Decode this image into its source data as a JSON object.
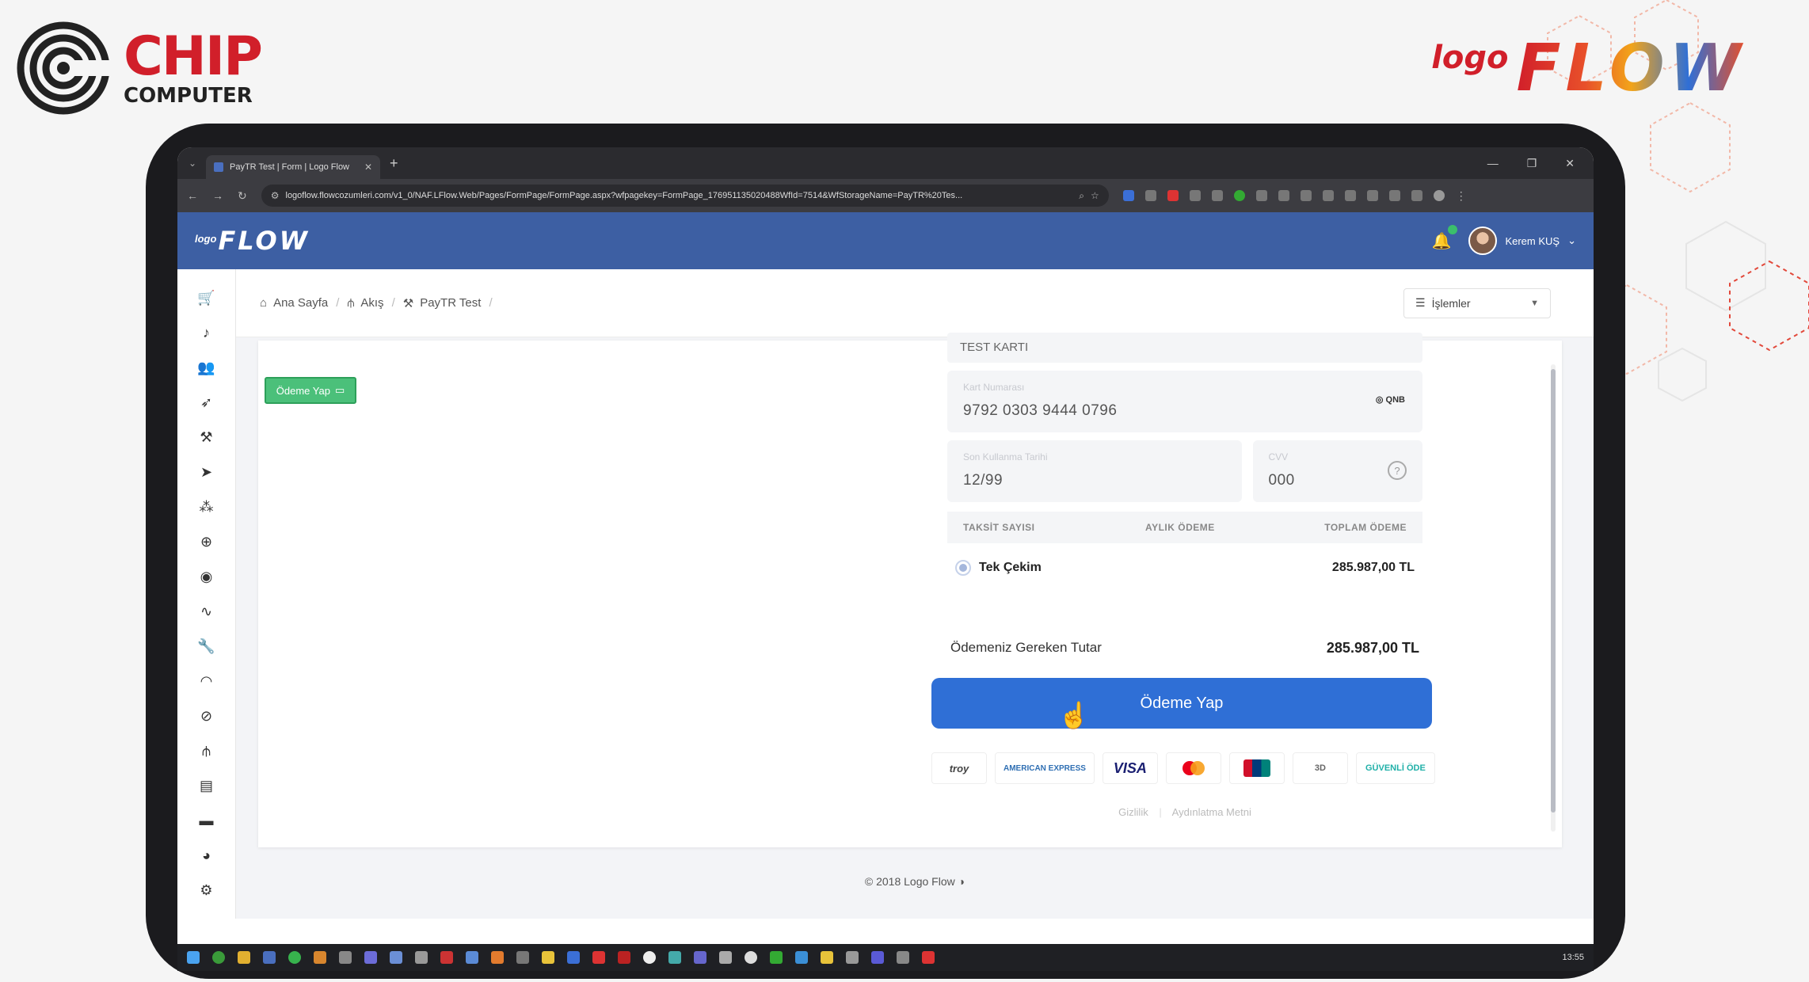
{
  "branding": {
    "chip_word": "CHIP",
    "chip_sub": "COMPUTER",
    "logo_small": "logo",
    "logo_big": "FLOW"
  },
  "browser": {
    "tab_title": "PayTR Test | Form | Logo Flow",
    "url": "logoflow.flowcozumleri.com/v1_0/NAF.LFlow.Web/Pages/FormPage/FormPage.aspx?wfpagekey=FormPage_176951135020488WfId=7514&WfStorageName=PayTR%20Tes..."
  },
  "app_header": {
    "logo_small": "logo",
    "logo_big": "FLOW",
    "user_name": "Kerem KUŞ"
  },
  "sidebar": {
    "items": [
      {
        "icon": "cart-icon",
        "glyph": "🛒"
      },
      {
        "icon": "music-icon",
        "glyph": "♪"
      },
      {
        "icon": "users-icon",
        "glyph": "👥"
      },
      {
        "icon": "rocket-icon",
        "glyph": "➶"
      },
      {
        "icon": "tools-icon",
        "glyph": "⚒"
      },
      {
        "icon": "send-icon",
        "glyph": "➤"
      },
      {
        "icon": "network-icon",
        "glyph": "⁂"
      },
      {
        "icon": "dollar-icon",
        "glyph": "⊕"
      },
      {
        "icon": "chat-icon",
        "glyph": "◉"
      },
      {
        "icon": "chart-line-icon",
        "glyph": "∿"
      },
      {
        "icon": "wrench-icon",
        "glyph": "🔧"
      },
      {
        "icon": "gauge-icon",
        "glyph": "◠"
      },
      {
        "icon": "ban-icon",
        "glyph": "⊘"
      },
      {
        "icon": "sitemap-icon",
        "glyph": "⫛"
      },
      {
        "icon": "document-icon",
        "glyph": "▤"
      },
      {
        "icon": "folder-icon",
        "glyph": "▬"
      },
      {
        "icon": "pie-icon",
        "glyph": "◕"
      },
      {
        "icon": "settings-icon",
        "glyph": "⚙"
      }
    ]
  },
  "breadcrumb": {
    "home": "Ana Sayfa",
    "flow": "Akış",
    "current": "PayTR Test"
  },
  "actions": {
    "islemler": "İşlemler"
  },
  "form": {
    "odeme_small": "Ödeme Yap"
  },
  "payment": {
    "card_name": "TEST KARTI",
    "card_number_label": "Kart Numarası",
    "card_number": "9792 0303 9444 0796",
    "bank": "QNB",
    "expiry_label": "Son Kullanma Tarihi",
    "expiry": "12/99",
    "cvv_label": "CVV",
    "cvv": "000",
    "installment_headers": [
      "TAKSİT SAYISI",
      "AYLIK ÖDEME",
      "TOPLAM ÖDEME"
    ],
    "installment_option": "Tek Çekim",
    "installment_total": "285.987,00 TL",
    "total_label": "Ödemeniz Gereken Tutar",
    "total_amount": "285.987,00 TL",
    "pay_button": "Ödeme Yap",
    "card_logos": {
      "troy": "troy",
      "amex": "AMERICAN EXPRESS",
      "visa": "VISA",
      "secure": "3D",
      "guvenli": "GÜVENLİ ÖDE"
    },
    "footer_links": [
      "Gizlilik",
      "Aydınlatma Metni"
    ]
  },
  "footer": {
    "copyright": "© 2018 Logo Flow"
  },
  "taskbar": {
    "time": "13:55"
  },
  "colors": {
    "header_bg": "#3d5fa3",
    "primary": "#2f6fd6",
    "success": "#4bc07a",
    "brand_red": "#d11f2a"
  }
}
